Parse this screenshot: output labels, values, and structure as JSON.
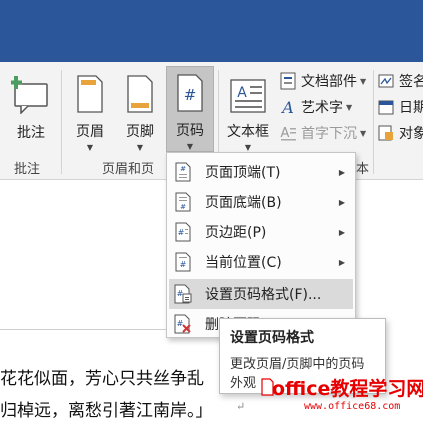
{
  "colors": {
    "titlebar": "#2b579a",
    "ribbon_bg": "#f3f3f3",
    "active_btn": "#c5c5c5",
    "watermark": "#e60000"
  },
  "ribbon": {
    "comment": {
      "label": "批注",
      "group_label": "批注"
    },
    "header": {
      "label": "页眉"
    },
    "footer": {
      "label": "页脚"
    },
    "page_number": {
      "label": "页码"
    },
    "header_footer_group_label": "页眉和页",
    "textbox": {
      "label": "文本框"
    },
    "text_group_label_tail": "本",
    "doc_parts": {
      "label": "文档部件"
    },
    "wordart": {
      "label": "艺术字"
    },
    "drop_cap": {
      "label": "首字下沉"
    },
    "signature": {
      "label": "签名"
    },
    "date": {
      "label": "日期"
    },
    "object": {
      "label": "对象"
    }
  },
  "menu": {
    "items": [
      {
        "label": "页面顶端(T)",
        "icon": "page-top-icon",
        "submenu": true
      },
      {
        "label": "页面底端(B)",
        "icon": "page-bottom-icon",
        "submenu": true
      },
      {
        "label": "页边距(P)",
        "icon": "page-margin-icon",
        "submenu": true
      },
      {
        "label": "当前位置(C)",
        "icon": "current-position-icon",
        "submenu": true
      },
      {
        "label": "设置页码格式(F)...",
        "icon": "format-page-number-icon",
        "submenu": false
      },
      {
        "label": "删除页码",
        "icon": "remove-page-number-icon",
        "submenu": false
      }
    ]
  },
  "tooltip": {
    "title": "设置页码格式",
    "description": "更改页眉/页脚中的页码外观"
  },
  "document": {
    "lines": [
      "花花似面，芳心只共丝争乱",
      "归棹远，离愁引著江南岸。」"
    ],
    "paragraph_mark": "↵"
  },
  "watermark": {
    "main": "office教程学习网",
    "url": "www.office68.com"
  }
}
